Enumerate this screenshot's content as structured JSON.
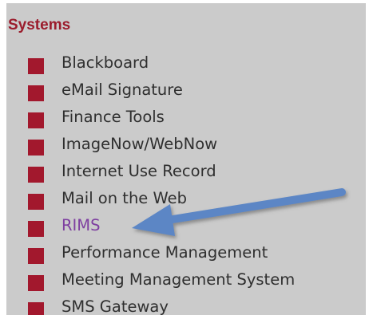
{
  "section": {
    "title": "Systems"
  },
  "nav_items": [
    {
      "label": "Blackboard"
    },
    {
      "label": "eMail Signature"
    },
    {
      "label": "Finance Tools"
    },
    {
      "label": "ImageNow/WebNow"
    },
    {
      "label": "Internet Use Record"
    },
    {
      "label": "Mail on the Web"
    },
    {
      "label": "RIMS"
    },
    {
      "label": "Performance Management"
    },
    {
      "label": "Meeting Management System"
    },
    {
      "label": "SMS Gateway"
    }
  ],
  "colors": {
    "panel_background": "#cbcbcb",
    "title": "#9b1c2c",
    "bullet": "#a2182d",
    "link": "#2f2f2f",
    "visited_link": "#7e3fa0",
    "annotation_arrow": "#5b86c5"
  },
  "annotation": {
    "arrow_icon": "arrow-left-icon",
    "target": "RIMS"
  }
}
